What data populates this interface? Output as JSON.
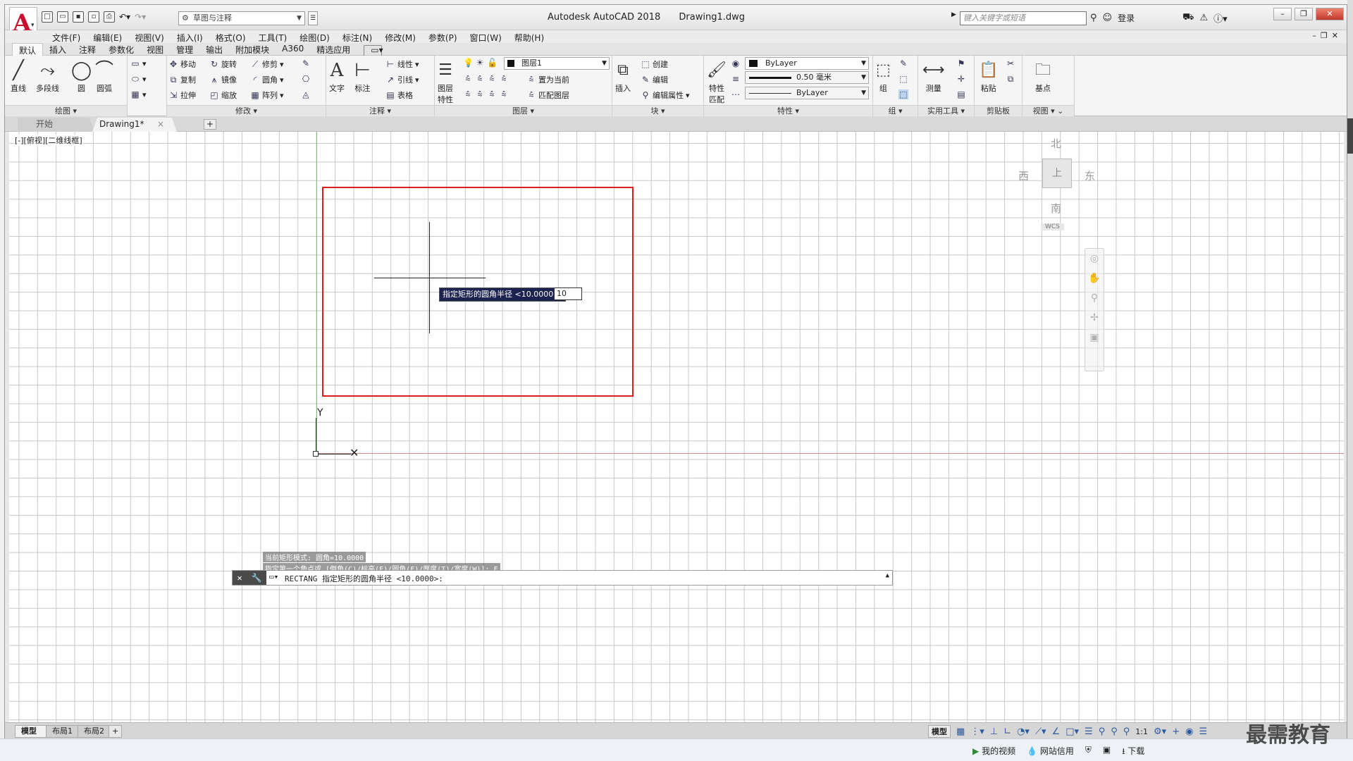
{
  "app": {
    "name": "Autodesk AutoCAD 2018",
    "file": "Drawing1.dwg",
    "workspace": "草图与注释",
    "search_placeholder": "键入关键字或短语",
    "login": "登录"
  },
  "menu": [
    "文件(F)",
    "编辑(E)",
    "视图(V)",
    "插入(I)",
    "格式(O)",
    "工具(T)",
    "绘图(D)",
    "标注(N)",
    "修改(M)",
    "参数(P)",
    "窗口(W)",
    "帮助(H)"
  ],
  "ribbon_tabs": [
    "默认",
    "插入",
    "注释",
    "参数化",
    "视图",
    "管理",
    "输出",
    "附加模块",
    "A360",
    "精选应用"
  ],
  "ribbon": {
    "draw": {
      "title": "绘图",
      "line": "直线",
      "polyline": "多段线",
      "circle": "圆",
      "arc": "圆弧"
    },
    "modify": {
      "title": "修改",
      "move": "移动",
      "rotate": "旋转",
      "trim": "修剪",
      "copy": "复制",
      "mirror": "镜像",
      "fillet": "圆角",
      "stretch": "拉伸",
      "scale": "缩放",
      "array": "阵列"
    },
    "annotation": {
      "title": "注释",
      "text": "文字",
      "dimension": "标注",
      "linear": "线性",
      "leader": "引线",
      "table": "表格"
    },
    "layers": {
      "title": "图层",
      "layer_props_1": "图层",
      "layer_props_2": "特性",
      "current_layer": "图层1",
      "make_current": "置为当前",
      "match_layer": "匹配图层"
    },
    "block": {
      "title": "块",
      "insert": "插入",
      "create": "创建",
      "edit": "编辑",
      "edit_attr": "编辑属性"
    },
    "properties": {
      "title": "特性",
      "match_1": "特性",
      "match_2": "匹配",
      "color": "ByLayer",
      "lineweight": "0.50 毫米",
      "linetype": "ByLayer"
    },
    "groups": {
      "title": "组",
      "group": "组"
    },
    "utilities": {
      "title": "实用工具",
      "measure": "测量"
    },
    "clipboard": {
      "title": "剪贴板",
      "paste": "粘贴"
    },
    "view": {
      "title": "视图",
      "base": "基点"
    }
  },
  "file_tabs": {
    "start": "开始",
    "drawing": "Drawing1*"
  },
  "viewport_label": "[-][俯视][二维线框]",
  "viewcube": {
    "north": "北",
    "south": "南",
    "east": "东",
    "west": "西",
    "face": "上",
    "wcs": "WCS"
  },
  "dynamic_input": {
    "prompt": "指定矩形的圆角半径 <10.0000>:",
    "value": "10"
  },
  "ucs": {
    "y": "Y",
    "x": "X"
  },
  "command_history": [
    "当前矩形模式:  圆角=10.0000",
    "指定第一个角点或 [倒角(C)/标高(E)/圆角(F)/厚度(T)/宽度(W)]: F"
  ],
  "command_line": "RECTANG 指定矩形的圆角半径 <10.0000>:",
  "layout_tabs": [
    "模型",
    "布局1",
    "布局2"
  ],
  "status": {
    "model": "模型",
    "scale": "1:1"
  },
  "os_strip": [
    "我的视频",
    "网站信用",
    "下载"
  ],
  "watermark": "最需教育"
}
